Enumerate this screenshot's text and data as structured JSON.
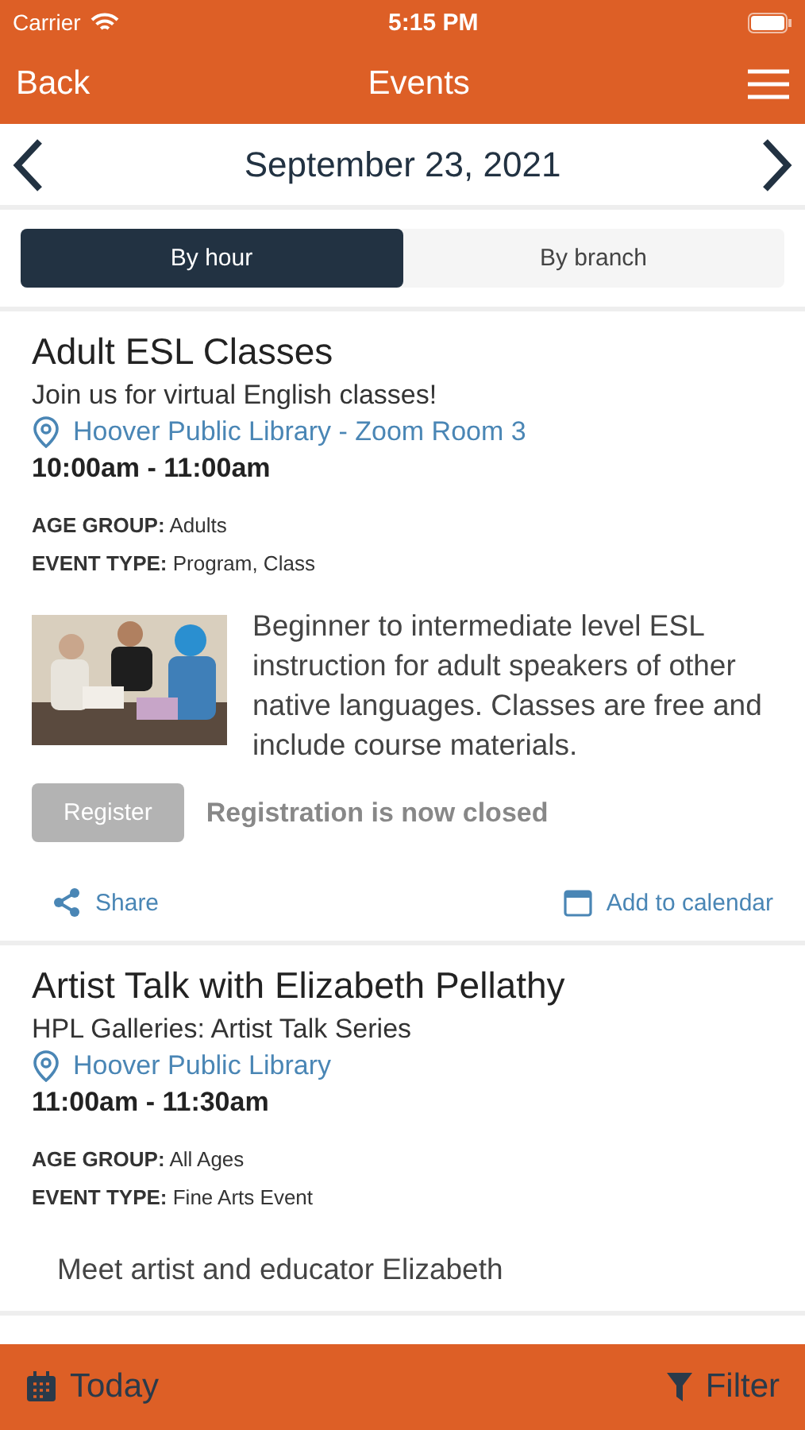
{
  "status_bar": {
    "carrier": "Carrier",
    "time": "5:15 PM"
  },
  "nav": {
    "back": "Back",
    "title": "Events"
  },
  "date_bar": {
    "date": "September 23, 2021"
  },
  "tabs": [
    {
      "label": "By hour",
      "selected": true
    },
    {
      "label": "By branch",
      "selected": false
    }
  ],
  "events": [
    {
      "title": "Adult ESL Classes",
      "subtitle": "Join us for virtual English classes!",
      "location": "Hoover Public Library - Zoom Room 3",
      "time": "10:00am - 11:00am",
      "age_group": "**AGE GROUP:** Adults",
      "event_type": "**EVENT TYPE:** Program, Class",
      "description": "Beginner to intermediate level ESL instruction for adult speakers of other native languages. Classes are free and include course materials.",
      "register": {
        "label": "Register",
        "disabled": true
      },
      "registration_note": "Registration is now closed",
      "share": "Share",
      "calendar": "Add to calendar"
    },
    {
      "title": "Artist Talk with Elizabeth Pellathy",
      "subtitle": "HPL Galleries: Artist Talk Series",
      "location": "Hoover Public Library",
      "time": "11:00am - 11:30am",
      "age_group": "**AGE GROUP:** All Ages",
      "event_type": "**EVENT TYPE:** Fine Arts Event",
      "description": "Meet artist and educator Elizabeth"
    }
  ],
  "bottom_bar": {
    "today": "Today",
    "filter": "Filter"
  }
}
